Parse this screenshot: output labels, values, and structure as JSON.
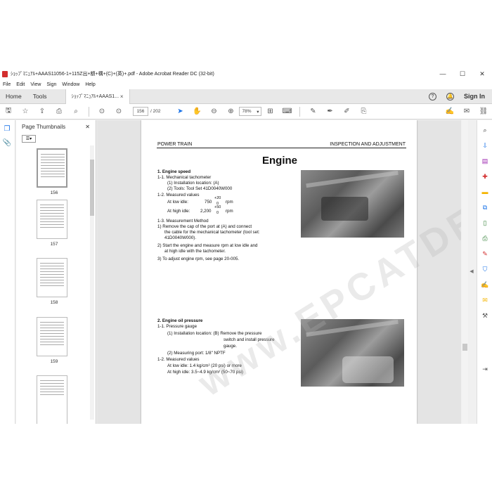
{
  "window": {
    "title": "ｼｮｯﾌﾟﾏﾆｭｱﾙ+AAAS11056-1+115Z出+額+構+(C)+(英)+.pdf - Adobe Acrobat Reader DC (32-bit)",
    "minimize": "—",
    "maximize": "☐",
    "close": "✕"
  },
  "menu": [
    "File",
    "Edit",
    "View",
    "Sign",
    "Window",
    "Help"
  ],
  "tabs": {
    "home": "Home",
    "tools": "Tools",
    "doc": "ｼｮｯﾌﾟﾏﾆｭｱﾙ+AAAS1...",
    "doc_close": "×",
    "sign_in": "Sign In"
  },
  "toolbar": {
    "page_current": "156",
    "page_total": "/ 202",
    "zoom": "78%"
  },
  "thumbnails": {
    "title": "Page Thumbnails",
    "close": "✕",
    "pages": [
      "156",
      "157",
      "158",
      "159"
    ]
  },
  "doc": {
    "header_left": "POWER TRAIN",
    "header_right": "INSPECTION AND ADJUSTMENT",
    "title": "Engine",
    "watermark": "www.EPCATDEPOT.COM",
    "lines1": [
      "1.   Engine speed",
      "1-1.   Mechanical tachometer",
      "(1)  Installation location:  (A)",
      "(2)  Tools: Tool Set 41D0040W000",
      "1-2.   Measured values",
      "At low idle:",
      "750",
      "+20",
      "0",
      "rpm",
      "At high idle:",
      "2,200",
      "+50",
      "0",
      "rpm",
      "1-3.   Measurement Method",
      "1)   Remove the cap of the port at (A) and connect",
      "the cable for the mechanical tachometer (tool set:",
      "41D0040W000).",
      "2)   Start the engine and measure rpm at low idle and",
      "at high idle with the tachometer.",
      "3)   To adjust engine rpm, see page 20-005."
    ],
    "lines2": [
      "2.   Engine oil pressure",
      "1-1.   Pressure gauge",
      "(1)  Installation location:  (B) Remove the pressure",
      "switch and install pressure",
      "gauge.",
      "(2)  Measuring port:         1/8\" NPTF",
      "1-2.   Measured values",
      "At low idle:     1.4 kg/cm²  (20 psi) or more",
      "At high idle:   3.5~4.9 kg/cm²  (50~70 psi)"
    ]
  }
}
